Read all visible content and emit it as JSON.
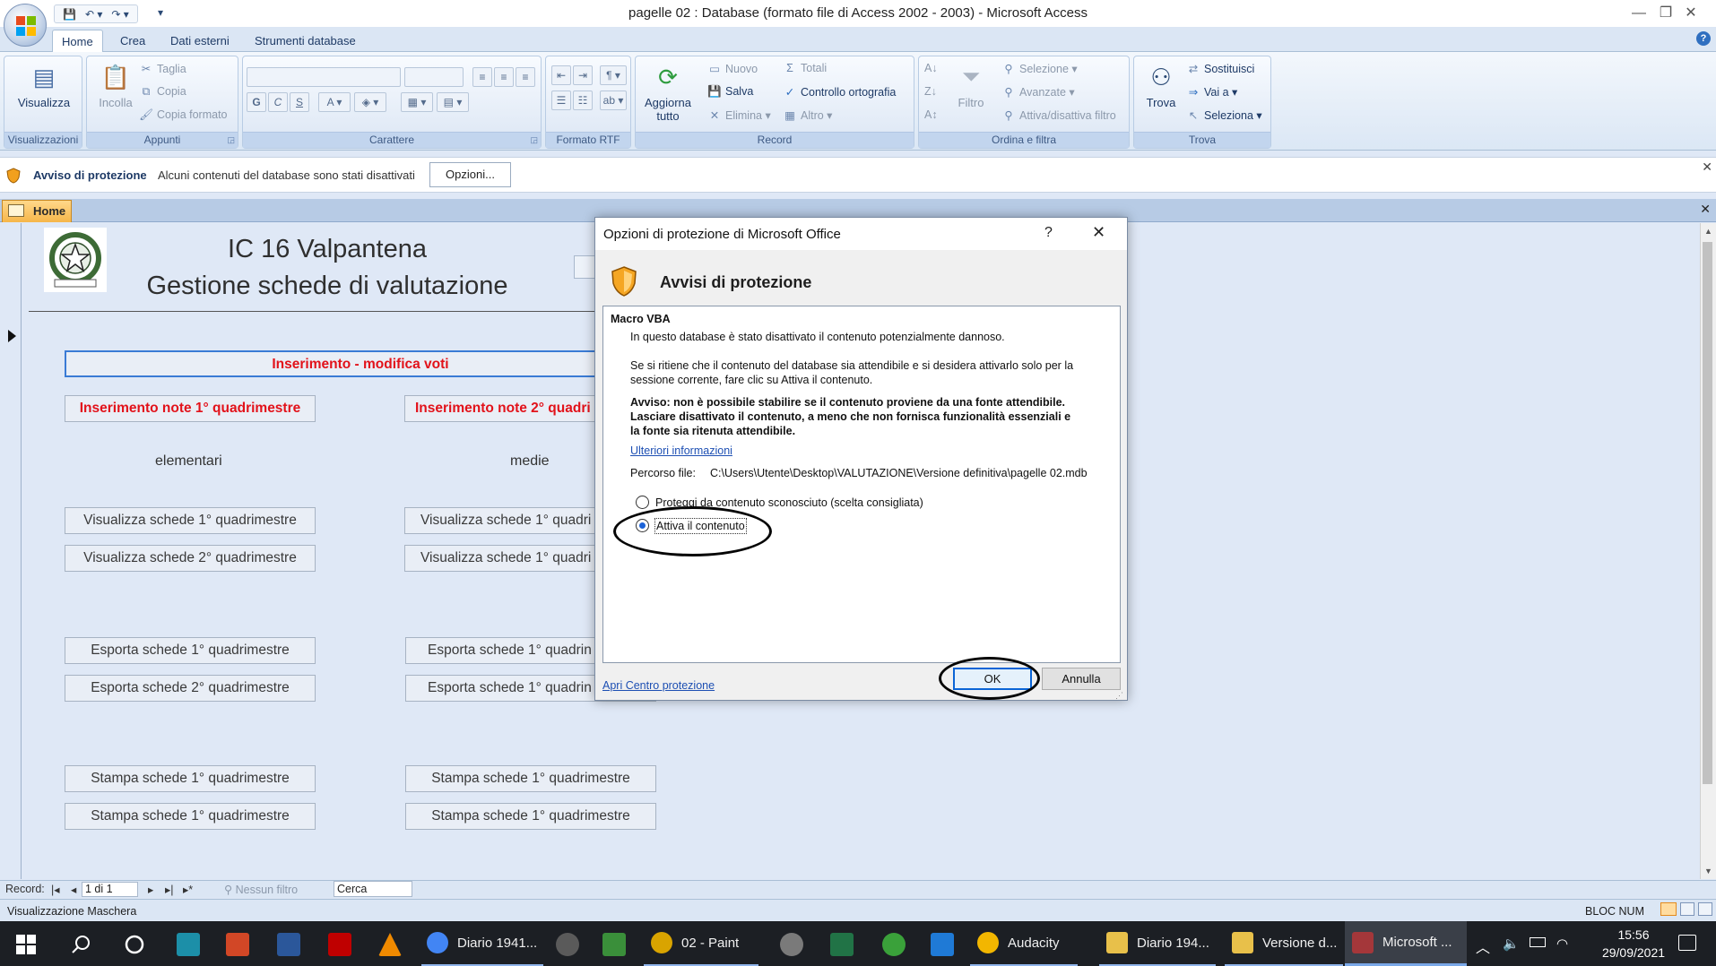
{
  "window": {
    "title": "pagelle 02 : Database (formato file di Access 2002 - 2003) - Microsoft Access",
    "controls": [
      "—",
      "❐",
      "✕"
    ]
  },
  "qat": {
    "save": "💾",
    "undo": "↶ ▾",
    "redo": "↷ ▾",
    "customize": "▾"
  },
  "ribbon": {
    "tabs": [
      "Home",
      "Crea",
      "Dati esterni",
      "Strumenti database"
    ],
    "help": "?",
    "groups": {
      "views": {
        "label": "Visualizzazioni",
        "visualizza": "Visualizza"
      },
      "clipboard": {
        "label": "Appunti",
        "incolla": "Incolla",
        "taglia": "Taglia",
        "copia": "Copia",
        "copia_formato": "Copia formato"
      },
      "font": {
        "label": "Carattere",
        "bold": "G",
        "italic": "C",
        "underline": "S"
      },
      "rtf": {
        "label": "Formato RTF"
      },
      "records": {
        "label": "Record",
        "aggiorna": "Aggiorna",
        "aggiorna2": "tutto",
        "nuovo": "Nuovo",
        "salva": "Salva",
        "elimina": "Elimina",
        "totali": "Totali",
        "controllo": "Controllo ortografia",
        "altro": "Altro"
      },
      "sort": {
        "label": "Ordina e filtra",
        "filtro": "Filtro",
        "selezione": "Selezione",
        "avanzate": "Avanzate",
        "attiva_filtro": "Attiva/disattiva filtro"
      },
      "find": {
        "label": "Trova",
        "trova": "Trova",
        "sostituisci": "Sostituisci",
        "vai_a": "Vai a",
        "seleziona": "Seleziona"
      }
    }
  },
  "security_bar": {
    "title": "Avviso di protezione",
    "message": "Alcuni contenuti del database sono stati disattivati",
    "options_button": "Opzioni...",
    "close": "✕"
  },
  "doc_tab": {
    "label": "Home",
    "close": "✕"
  },
  "form": {
    "title_line1": "IC 16 Valpantena",
    "title_line2": "Gestione schede di valutazione",
    "header_button": "Inserimento - modifica voti",
    "left_col": {
      "note": "Inserimento note 1° quadrimestre",
      "label": "elementari",
      "vis1": "Visualizza schede 1° quadrimestre",
      "vis2": "Visualizza schede 2° quadrimestre",
      "esp1": "Esporta schede 1° quadrimestre",
      "esp2": "Esporta schede 2° quadrimestre",
      "sta1": "Stampa schede 1° quadrimestre",
      "sta2": "Stampa schede 1° quadrimestre"
    },
    "right_col": {
      "note": "Inserimento note 2° quadri",
      "label": "medie",
      "vis1": "Visualizza schede 1° quadri",
      "vis2": "Visualizza schede 1° quadri",
      "esp1": "Esporta schede 1° quadrin",
      "esp2": "Esporta schede 1° quadrin",
      "sta1": "Stampa schede 1° quadrimestre",
      "sta2": "Stampa schede 1° quadrimestre"
    }
  },
  "navigation": {
    "record_label": "Record:",
    "first": "|◂",
    "prev": "◂",
    "position": "1 di 1",
    "next": "▸",
    "last": "▸|",
    "new": "▸*",
    "filter": "Nessun filtro",
    "search": "Cerca"
  },
  "status": {
    "left": "Visualizzazione Maschera",
    "right": "BLOC NUM"
  },
  "dialog": {
    "title": "Opzioni di protezione di Microsoft Office",
    "help": "?",
    "close": "✕",
    "heading": "Avvisi di protezione",
    "section": "Macro VBA",
    "p1": "In questo database è stato disattivato il contenuto potenzialmente dannoso.",
    "p2a": "Se si ritiene che il contenuto del database sia attendibile e si desidera attivarlo solo per la",
    "p2b": "sessione corrente, fare clic su Attiva il contenuto.",
    "warn1": "Avviso: non è possibile stabilire se il contenuto proviene da una fonte attendibile.",
    "warn2": "Lasciare disattivato il contenuto, a meno che non fornisca funzionalità essenziali e",
    "warn3": "la fonte sia ritenuta attendibile.",
    "more_info": "Ulteriori informazioni",
    "path_label": "Percorso file:",
    "path_value": "C:\\Users\\Utente\\Desktop\\VALUTAZIONE\\Versione definitiva\\pagelle 02.mdb",
    "option_protect": "Proteggi da contenuto sconosciuto (scelta consigliata)",
    "option_enable": "Attiva il contenuto",
    "selected_option": "enable",
    "trust_center": "Apri Centro protezione",
    "ok": "OK",
    "cancel": "Annulla"
  },
  "taskbar": {
    "apps": [
      {
        "label": "Diario 1941...",
        "color": "#4285f4"
      },
      {
        "label": "02 - Paint",
        "color": "#d9a400"
      },
      {
        "label": "Audacity",
        "color": "#f2b600"
      },
      {
        "label": "Diario 194...",
        "color": "#e8c04a"
      },
      {
        "label": "Versione d...",
        "color": "#e8c04a"
      },
      {
        "label": "Microsoft ...",
        "color": "#a4373a"
      }
    ],
    "time": "15:56",
    "date": "29/09/2021"
  }
}
